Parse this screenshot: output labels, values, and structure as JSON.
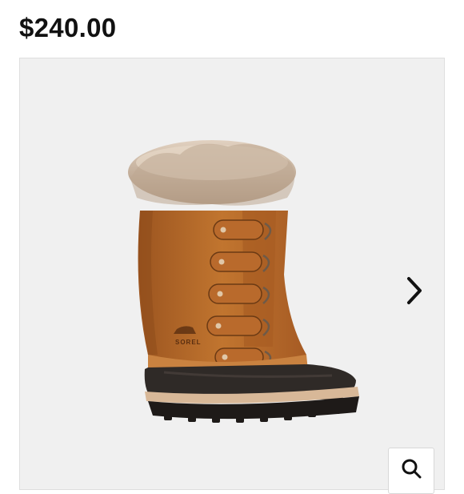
{
  "product": {
    "price": "$240.00",
    "image_brand_mark": "SOREL"
  },
  "colors": {
    "boot_suede": "#b8692a",
    "fur": "#cdb8a3",
    "rubber_shell": "#2f2a27",
    "gallery_bg": "#f0f0f0"
  },
  "icons": {
    "next": "chevron-right-icon",
    "zoom": "magnifier-icon"
  }
}
